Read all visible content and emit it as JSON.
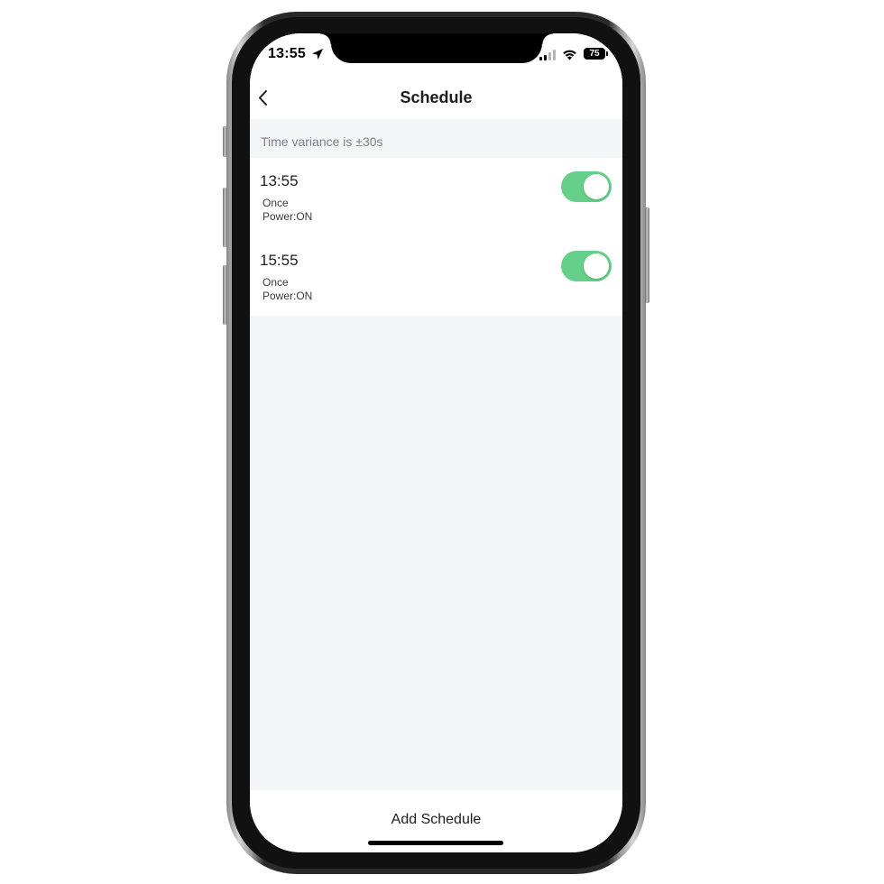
{
  "status_bar": {
    "time": "13:55",
    "battery": "75"
  },
  "header": {
    "title": "Schedule",
    "back_icon": "chevron-left-icon"
  },
  "variance_text": "Time variance is  ±30s",
  "schedules": [
    {
      "time": "13:55",
      "repeat": "Once",
      "action": "Power:ON",
      "enabled": true
    },
    {
      "time": "15:55",
      "repeat": "Once",
      "action": "Power:ON",
      "enabled": true
    }
  ],
  "footer": {
    "add_label": "Add Schedule"
  },
  "colors": {
    "toggle_on": "#66d08a",
    "background": "#f4f5f7"
  }
}
